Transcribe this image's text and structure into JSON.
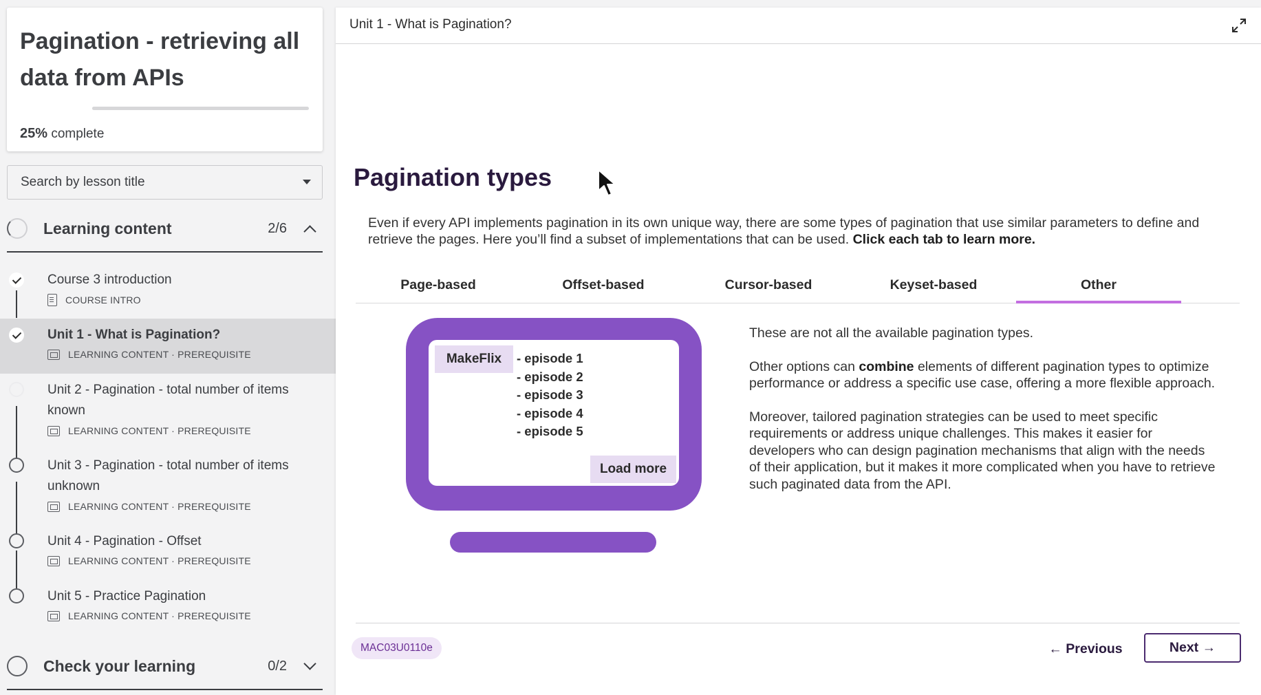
{
  "course": {
    "title": "Pagination - retrieving all data from APIs",
    "progress_percent": 25,
    "progress_value": "25%",
    "progress_suffix": "complete"
  },
  "search": {
    "placeholder": "Search by lesson title"
  },
  "sections": [
    {
      "label": "Learning content",
      "count": "2/6",
      "expanded": true
    },
    {
      "label": "Check your learning",
      "count": "0/2",
      "expanded": false
    }
  ],
  "lessons": [
    {
      "title": "Course 3 introduction",
      "meta": "COURSE INTRO",
      "status": "done"
    },
    {
      "title": "Unit 1 - What is Pagination?",
      "meta": "LEARNING CONTENT · PREREQUISITE",
      "status": "done",
      "active": true
    },
    {
      "title": "Unit 2 - Pagination - total number of items known",
      "meta": "LEARNING CONTENT · PREREQUISITE",
      "status": "not-started"
    },
    {
      "title": "Unit 3 - Pagination - total number of items unknown",
      "meta": "LEARNING CONTENT · PREREQUISITE",
      "status": "not-started"
    },
    {
      "title": "Unit 4 - Pagination - Offset",
      "meta": "LEARNING CONTENT · PREREQUISITE",
      "status": "not-started"
    },
    {
      "title": "Unit 5 - Practice Pagination",
      "meta": "LEARNING CONTENT · PREREQUISITE",
      "status": "not-started"
    }
  ],
  "main": {
    "header_title": "Unit 1 - What is Pagination?",
    "heading": "Pagination types",
    "intro_text": "Even if every API implements pagination in its own unique way, there are some types of pagination that use similar parameters to define and retrieve the pages. Here you’ll find a subset of implementations that can be used. ",
    "intro_bold": "Click each tab to learn more.",
    "tabs": [
      "Page-based",
      "Offset-based",
      "Cursor-based",
      "Keyset-based",
      "Other"
    ],
    "active_tab": "Other",
    "illustration": {
      "brand": "MakeFlix",
      "episodes": [
        "- episode 1",
        "- episode 2",
        "- episode 3",
        "- episode 4",
        "- episode 5"
      ],
      "load_more": "Load more"
    },
    "explanation": {
      "p1": "These are not all the available pagination types.",
      "p2_before": "Other options can ",
      "p2_bold": "combine",
      "p2_after": " elements of different pagination types to optimize performance or address a specific use case, offering a more flexible approach.",
      "p3": "Moreover, tailored pagination strategies can be used to meet specific requirements or address unique challenges. This makes it easier for developers who can design pagination mechanisms that align with the needs of their application, but it makes it more complicated when you have to retrieve such paginated data from the API."
    },
    "code_badge": "MAC03U0110e",
    "prev_label": "← Previous",
    "next_label": "Next →"
  },
  "colors": {
    "accent": "#8652c4",
    "tab_underline": "#c36ee0",
    "badge_bg": "#f0e6f7",
    "badge_text": "#6b2f95"
  }
}
